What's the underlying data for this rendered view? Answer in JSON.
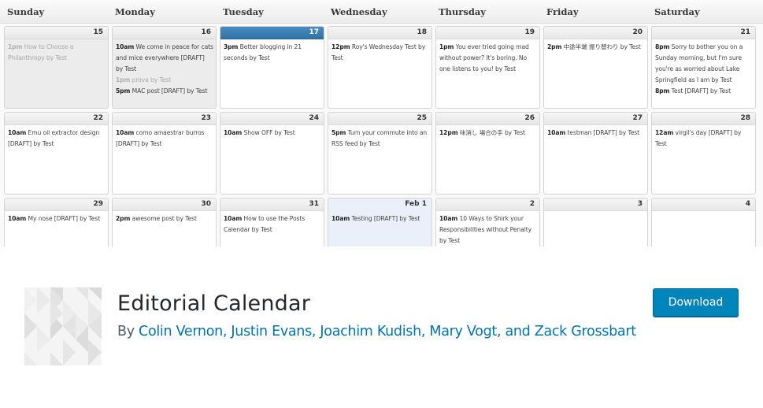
{
  "calendar": {
    "day_headers": [
      "Sunday",
      "Monday",
      "Tuesday",
      "Wednesday",
      "Thursday",
      "Friday",
      "Saturday"
    ],
    "weeks": [
      [
        {
          "date": "15",
          "state": "past",
          "posts": [
            {
              "time": "1pm",
              "title": "How to Choose a Philanthropy by Test",
              "faded": true
            }
          ]
        },
        {
          "date": "16",
          "state": "past",
          "posts": [
            {
              "time": "10am",
              "title": "We come in peace for cats and mice everywhere [DRAFT] by Test"
            },
            {
              "time": "1pm",
              "title": "prova by Test",
              "faded": true
            },
            {
              "time": "5pm",
              "title": "MAC post [DRAFT] by Test"
            }
          ]
        },
        {
          "date": "17",
          "state": "today",
          "posts": [
            {
              "time": "3pm",
              "title": "Better blogging in 21 seconds by Test"
            }
          ]
        },
        {
          "date": "18",
          "state": "",
          "posts": [
            {
              "time": "12pm",
              "title": "Roy's Wednesday Test by Test"
            }
          ]
        },
        {
          "date": "19",
          "state": "",
          "posts": [
            {
              "time": "1pm",
              "title": "You ever tried going mad without power? It's boring. No one listens to you! by Test"
            }
          ]
        },
        {
          "date": "20",
          "state": "",
          "posts": [
            {
              "time": "2pm",
              "title": "中途半端 振り替わり by Test"
            }
          ]
        },
        {
          "date": "21",
          "state": "",
          "posts": [
            {
              "time": "8pm",
              "title": "Sorry to bother you on a Sunday morning, but I'm sure you're as worried about Lake Springfield as I am by Test"
            },
            {
              "time": "8pm",
              "title": "Test [DRAFT] by Test"
            }
          ]
        }
      ],
      [
        {
          "date": "22",
          "state": "",
          "posts": [
            {
              "time": "10am",
              "title": "Emu oil extractor design [DRAFT] by Test"
            }
          ]
        },
        {
          "date": "23",
          "state": "",
          "posts": [
            {
              "time": "10am",
              "title": "como amaestrar burros [DRAFT] by Test"
            }
          ]
        },
        {
          "date": "24",
          "state": "",
          "posts": [
            {
              "time": "10am",
              "title": "Show OFF by Test"
            }
          ]
        },
        {
          "date": "25",
          "state": "",
          "posts": [
            {
              "time": "5pm",
              "title": "Turn your commute into an RSS feed by Test"
            }
          ]
        },
        {
          "date": "26",
          "state": "",
          "posts": [
            {
              "time": "12pm",
              "title": "味消し 場合の手 by Test"
            }
          ]
        },
        {
          "date": "27",
          "state": "",
          "posts": [
            {
              "time": "10am",
              "title": "testman [DRAFT] by Test"
            }
          ]
        },
        {
          "date": "28",
          "state": "",
          "posts": [
            {
              "time": "12am",
              "title": "virgil's day [DRAFT] by Test"
            }
          ]
        }
      ],
      [
        {
          "date": "29",
          "state": "",
          "posts": [
            {
              "time": "10am",
              "title": "My nose [DRAFT] by Test"
            }
          ]
        },
        {
          "date": "30",
          "state": "",
          "posts": [
            {
              "time": "2pm",
              "title": "awesome post by Test"
            }
          ]
        },
        {
          "date": "31",
          "state": "",
          "posts": [
            {
              "time": "10am",
              "title": "How to use the Posts Calendar by Test"
            }
          ]
        },
        {
          "date": "Feb 1",
          "state": "next-month",
          "posts": [
            {
              "time": "10am",
              "title": "Testing [DRAFT] by Test"
            }
          ]
        },
        {
          "date": "2",
          "state": "",
          "posts": [
            {
              "time": "10am",
              "title": "10 Ways to Shirk your Responsibilities without Penalty by Test"
            }
          ]
        },
        {
          "date": "3",
          "state": "",
          "posts": []
        },
        {
          "date": "4",
          "state": "",
          "posts": []
        }
      ]
    ]
  },
  "plugin": {
    "icon": "plugin-geometric-icon",
    "title": "Editorial Calendar",
    "by_label": "By",
    "authors": "Colin Vernon, Justin Evans, Joachim Kudish, Mary Vogt, and Zack Grossbart",
    "download_label": "Download",
    "colors": {
      "accent": "#0085ba",
      "link": "#0073aa",
      "today": "#3a7fb3"
    }
  }
}
